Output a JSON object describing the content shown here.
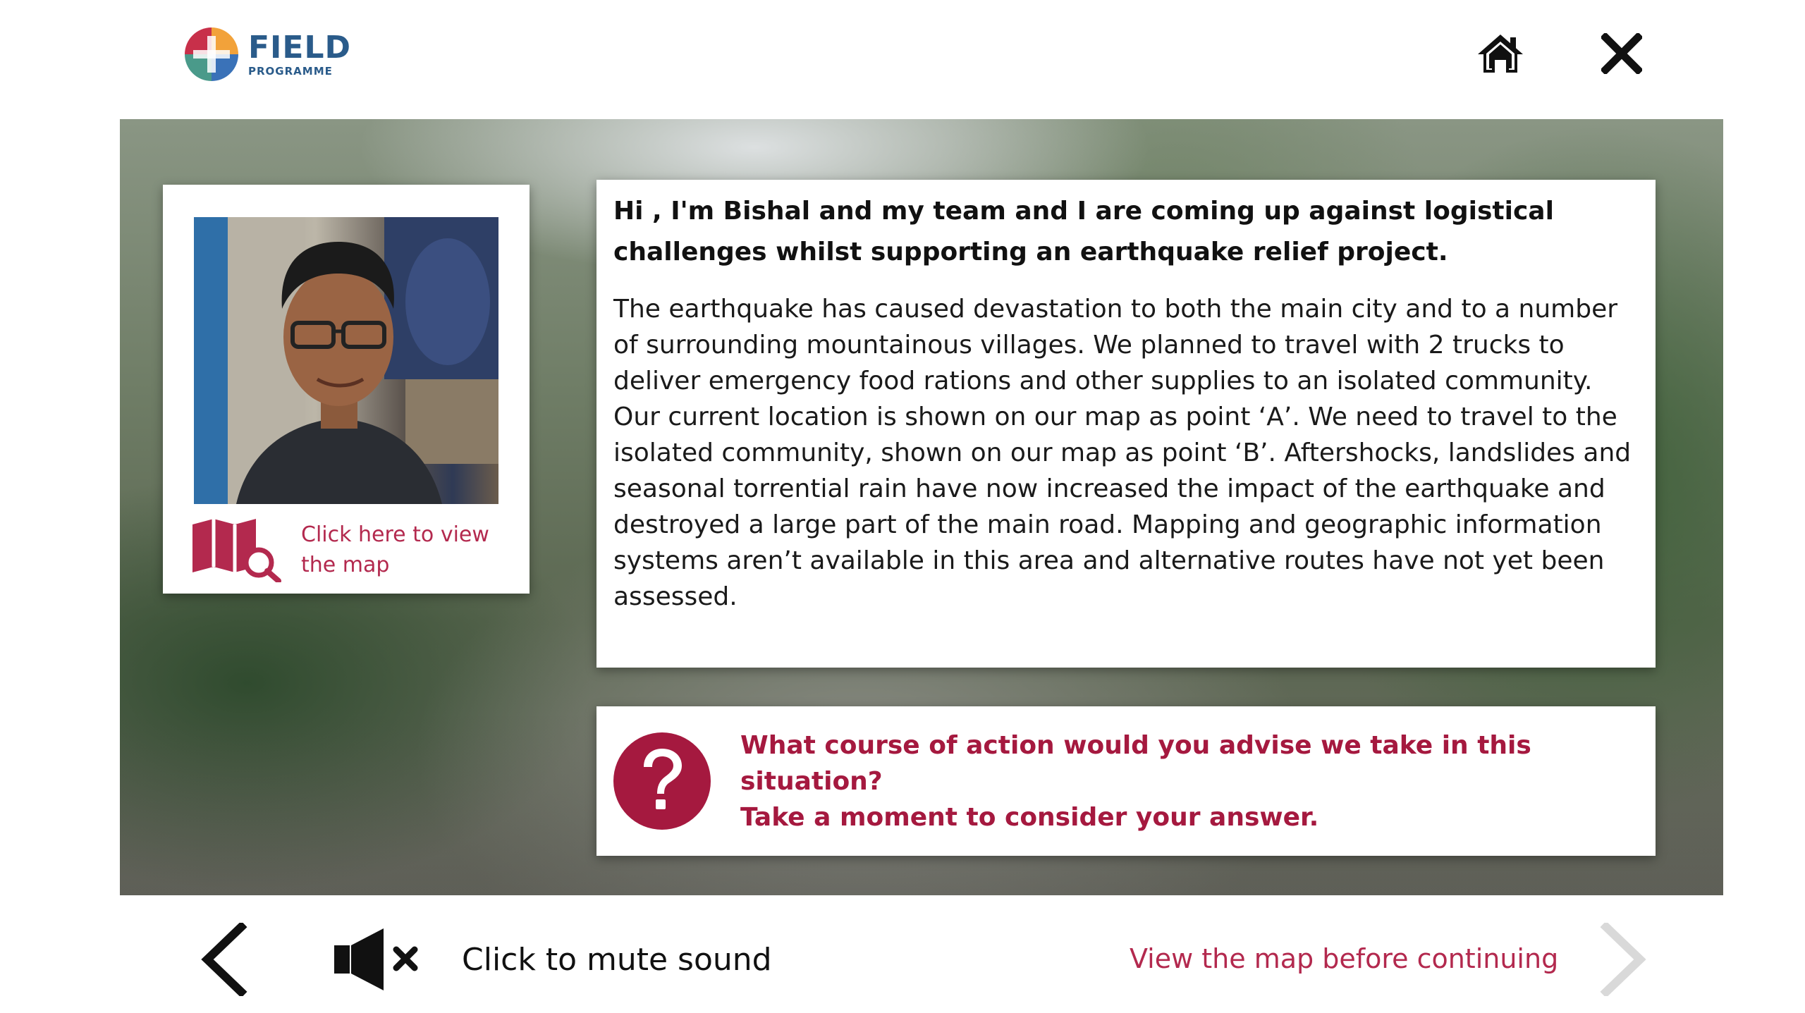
{
  "header": {
    "logo_title": "FIELD",
    "logo_subtitle": "PROGRAMME",
    "home_icon": "home-icon",
    "close_icon": "close-icon"
  },
  "portrait": {
    "map_link_text": "Click here to view the map",
    "map_icon": "map-search-icon"
  },
  "story": {
    "heading": "Hi , I'm Bishal and my team and I are coming up against logistical challenges whilst supporting an earthquake relief project.",
    "body": "The earthquake has caused devastation to both the main city and to a number of surrounding mountainous villages. We planned to travel with 2 trucks to deliver emergency food rations and other supplies to an isolated community. Our current location is shown on our map as point ‘A’. We need to travel to the isolated community, shown on our map as point ‘B’. Aftershocks, landslides and seasonal torrential rain have now increased the impact of the earthquake and destroyed a large part of the main road. Mapping and geographic information systems aren’t available in this area and alternative routes have not yet been assessed."
  },
  "question": {
    "icon": "question-mark-icon",
    "line1": "What course of action would you advise we take in this situation?",
    "line2": "Take a moment to consider your answer."
  },
  "footer": {
    "back_icon": "chevron-left-icon",
    "mute_icon": "speaker-mute-icon",
    "mute_label": "Click to mute sound",
    "continue_message": "View the map before continuing",
    "next_icon": "chevron-right-icon",
    "next_enabled": false
  },
  "colors": {
    "accent": "#a5193f",
    "link": "#b3294e",
    "brand_blue": "#2a5b8a",
    "disabled": "#d9d9d9"
  }
}
